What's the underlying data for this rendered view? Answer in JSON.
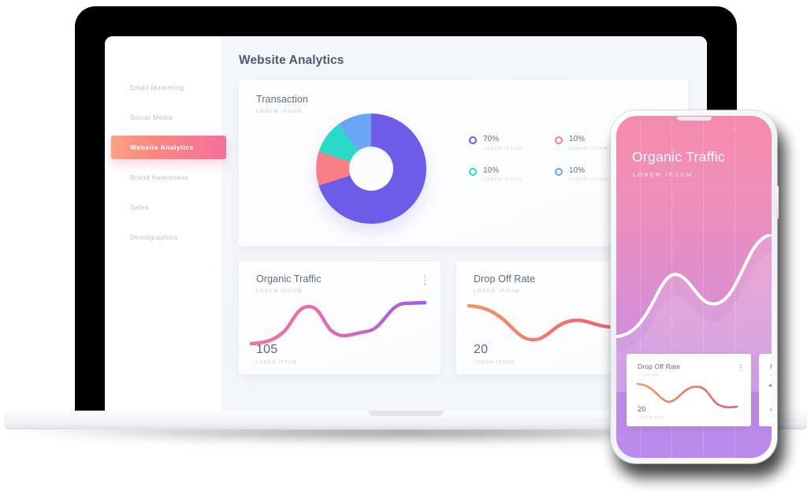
{
  "laptop": {
    "sidebar": {
      "items": [
        {
          "label": "Email Marketing",
          "active": false
        },
        {
          "label": "Social Media",
          "active": false
        },
        {
          "label": "Website Analytics",
          "active": true
        },
        {
          "label": "Brand Awareness",
          "active": false
        },
        {
          "label": "Sales",
          "active": false
        },
        {
          "label": "Demographics",
          "active": false
        }
      ]
    },
    "page_title": "Website Analytics",
    "transaction_card": {
      "title": "Transaction",
      "subtitle": "LOREM IPSUM",
      "legend": [
        {
          "value": "70%",
          "sub": "LOREM IPSUM",
          "color": "#6c5ce7"
        },
        {
          "value": "10%",
          "sub": "LOREM IPSUM",
          "color": "#f97f84"
        },
        {
          "value": "10%",
          "sub": "LOREM IPSUM",
          "color": "#2bd9c8"
        },
        {
          "value": "10%",
          "sub": "LOREM IPSUM",
          "color": "#6aa6f5"
        }
      ]
    },
    "organic_traffic_card": {
      "title": "Organic Traffic",
      "subtitle": "LOREM IPSUM",
      "value": "105",
      "value_sub": "LOREM IPSUM",
      "line_start_color": "#f2719c",
      "line_end_color": "#9b5ce8"
    },
    "drop_off_card": {
      "title": "Drop Off Rate",
      "subtitle": "LOREM IPSUM",
      "value": "20",
      "value_sub": "LOREM IPSUM",
      "line_start_color": "#f79364",
      "line_end_color": "#ee5a6e"
    }
  },
  "phone": {
    "title": "Organic Traffic",
    "subtitle": "LOREM IPSUM",
    "bg_start": "#f58bab",
    "bg_end": "#b98bee",
    "cards": [
      {
        "title": "Drop Off Rate",
        "subtitle": "Lorem Ips",
        "value": "20",
        "value_sub": "LOREM IPSU",
        "line_start_color": "#f79364",
        "line_end_color": "#ee5a6e"
      },
      {
        "title": "R",
        "subtitle": "Lo",
        "value": "4",
        "value_sub": "LO",
        "line_start_color": "#f79364",
        "line_end_color": "#ee5a6e"
      }
    ]
  },
  "chart_data": [
    {
      "type": "pie",
      "title": "Transaction",
      "subtitle": "LOREM IPSUM",
      "labels": [
        "70%",
        "10%",
        "10%",
        "10%"
      ],
      "values": [
        70,
        10,
        10,
        10
      ],
      "colors": [
        "#6c5ce7",
        "#f97f84",
        "#2bd9c8",
        "#6aa6f5"
      ],
      "legend_position": "right",
      "donut": true,
      "legend_sublabels": [
        "LOREM IPSUM",
        "LOREM IPSUM",
        "LOREM IPSUM",
        "LOREM IPSUM"
      ]
    },
    {
      "type": "line",
      "title": "Organic Traffic",
      "subtitle": "LOREM IPSUM",
      "summary_value": 105,
      "x": [
        0,
        1,
        2,
        3,
        4,
        5,
        6,
        7,
        8
      ],
      "values": [
        12,
        16,
        30,
        58,
        68,
        52,
        40,
        44,
        72
      ],
      "ylim": [
        0,
        80
      ],
      "grid": false,
      "legend_position": "none"
    },
    {
      "type": "line",
      "title": "Drop Off Rate",
      "subtitle": "LOREM IPSUM",
      "summary_value": 20,
      "x": [
        0,
        1,
        2,
        3,
        4,
        5,
        6,
        7
      ],
      "values": [
        68,
        60,
        40,
        20,
        18,
        34,
        46,
        44
      ],
      "ylim": [
        0,
        80
      ],
      "grid": false,
      "legend_position": "none"
    },
    {
      "type": "area",
      "title": "Organic Traffic",
      "subtitle": "LOREM IPSUM",
      "x": [
        0,
        1,
        2,
        3,
        4,
        5,
        6,
        7,
        8
      ],
      "values": [
        10,
        22,
        54,
        70,
        58,
        46,
        50,
        74,
        96
      ],
      "ylim": [
        0,
        100
      ],
      "grid": true,
      "legend_position": "none"
    }
  ]
}
